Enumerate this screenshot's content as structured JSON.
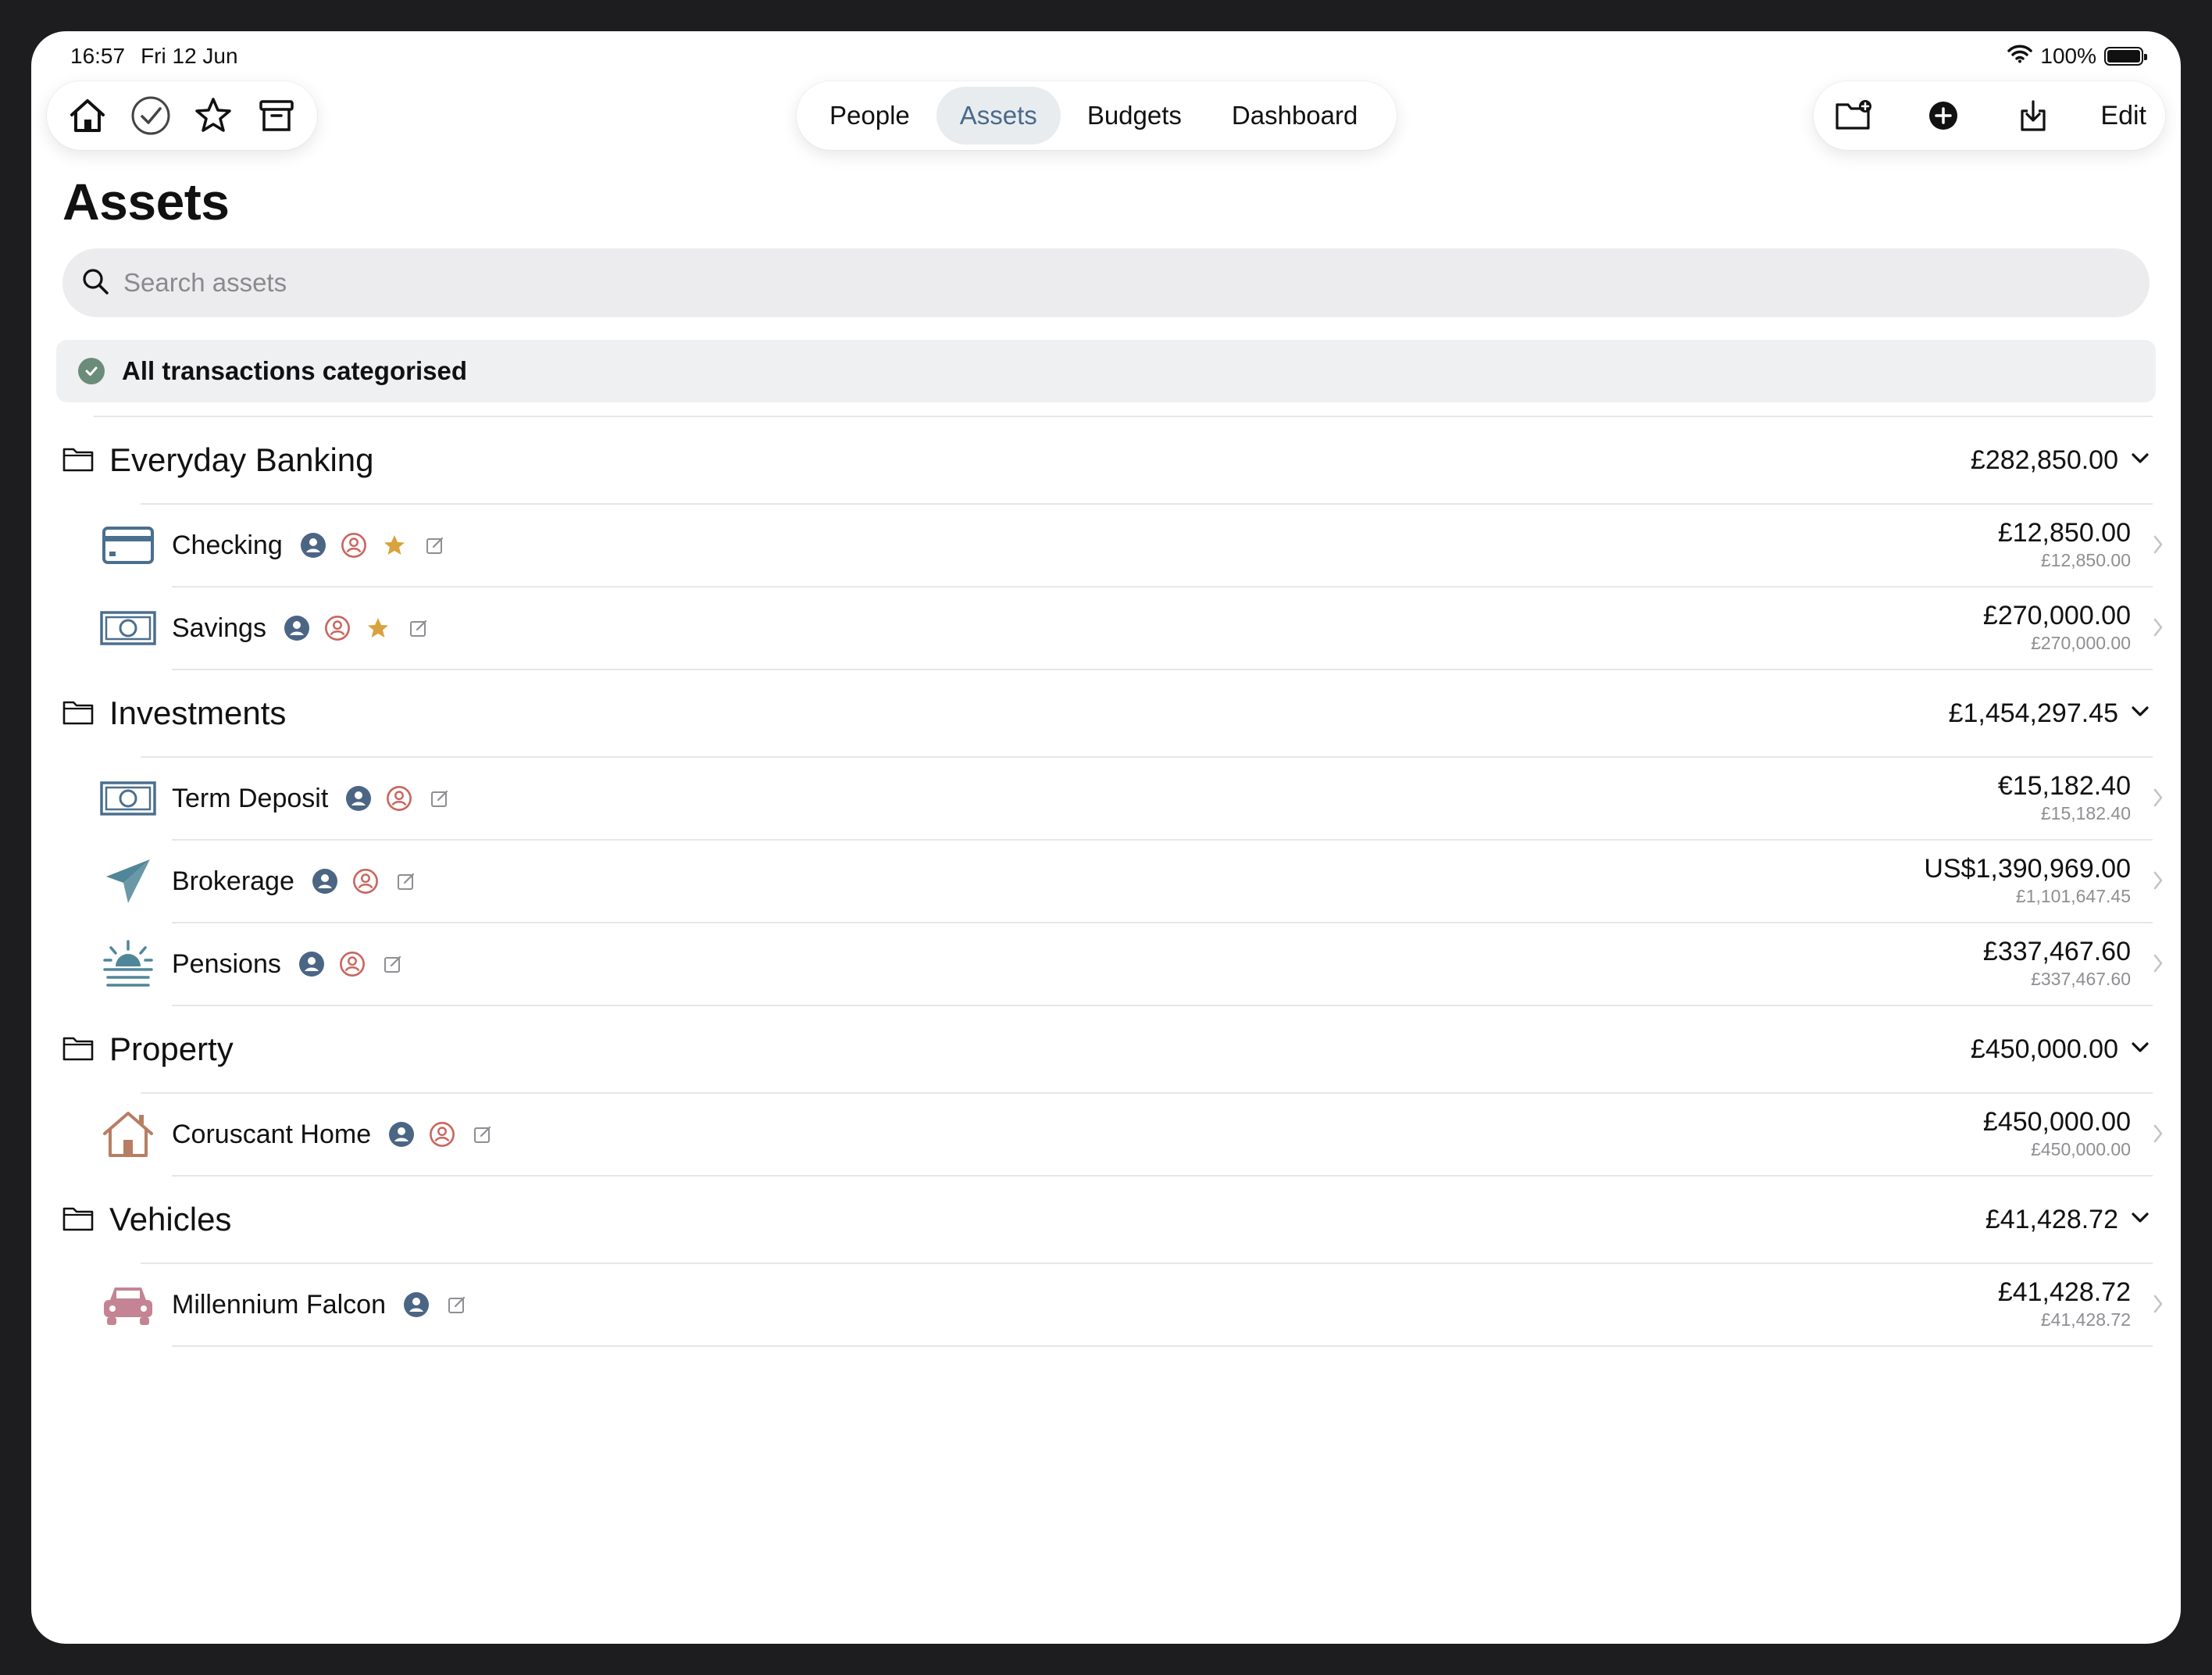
{
  "status_bar": {
    "time": "16:57",
    "date": "Fri 12 Jun",
    "battery": "100%",
    "icons": [
      "wifi-icon",
      "battery-icon"
    ]
  },
  "toolbar": {
    "left_icons": [
      "home-icon",
      "checkmark-circle-icon",
      "star-icon",
      "archive-icon"
    ],
    "tabs": [
      {
        "label": "People",
        "active": false
      },
      {
        "label": "Assets",
        "active": true
      },
      {
        "label": "Budgets",
        "active": false
      },
      {
        "label": "Dashboard",
        "active": false
      }
    ],
    "right_icons": [
      "new-folder-icon",
      "add-circle-icon",
      "import-icon"
    ],
    "edit_label": "Edit"
  },
  "page": {
    "title": "Assets",
    "search_placeholder": "Search assets",
    "banner": "All transactions categorised"
  },
  "colors": {
    "accent_tab": "#4a6a8a",
    "check_green": "#6b8c78",
    "owner_blue": "#4b6584",
    "owner_red": "#c9665e",
    "favorite_star": "#d8a23e",
    "icon_blue": "#4a6f8f",
    "icon_teal": "#4f8798",
    "icon_brown": "#b77e63",
    "icon_pink": "#c48493"
  },
  "groups": [
    {
      "name": "Everyday Banking",
      "total": "£282,850.00",
      "assets": [
        {
          "name": "Checking",
          "icon": "credit-card-icon",
          "primary": "£12,850.00",
          "secondary": "£12,850.00",
          "owners": 2,
          "favorite": true
        },
        {
          "name": "Savings",
          "icon": "banknote-icon",
          "primary": "£270,000.00",
          "secondary": "£270,000.00",
          "owners": 2,
          "favorite": true
        }
      ]
    },
    {
      "name": "Investments",
      "total": "£1,454,297.45",
      "assets": [
        {
          "name": "Term Deposit",
          "icon": "banknote-icon",
          "primary": "€15,182.40",
          "secondary": "£15,182.40",
          "owners": 2,
          "favorite": false
        },
        {
          "name": "Brokerage",
          "icon": "paper-plane-icon",
          "primary": "US$1,390,969.00",
          "secondary": "£1,101,647.45",
          "owners": 2,
          "favorite": false
        },
        {
          "name": "Pensions",
          "icon": "sunset-icon",
          "primary": "£337,467.60",
          "secondary": "£337,467.60",
          "owners": 2,
          "favorite": false
        }
      ]
    },
    {
      "name": "Property",
      "total": "£450,000.00",
      "assets": [
        {
          "name": "Coruscant Home",
          "icon": "house-icon",
          "primary": "£450,000.00",
          "secondary": "£450,000.00",
          "owners": 2,
          "favorite": false
        }
      ]
    },
    {
      "name": "Vehicles",
      "total": "£41,428.72",
      "assets": [
        {
          "name": "Millennium Falcon",
          "icon": "car-icon",
          "primary": "£41,428.72",
          "secondary": "£41,428.72",
          "owners": 1,
          "favorite": false
        }
      ]
    }
  ]
}
